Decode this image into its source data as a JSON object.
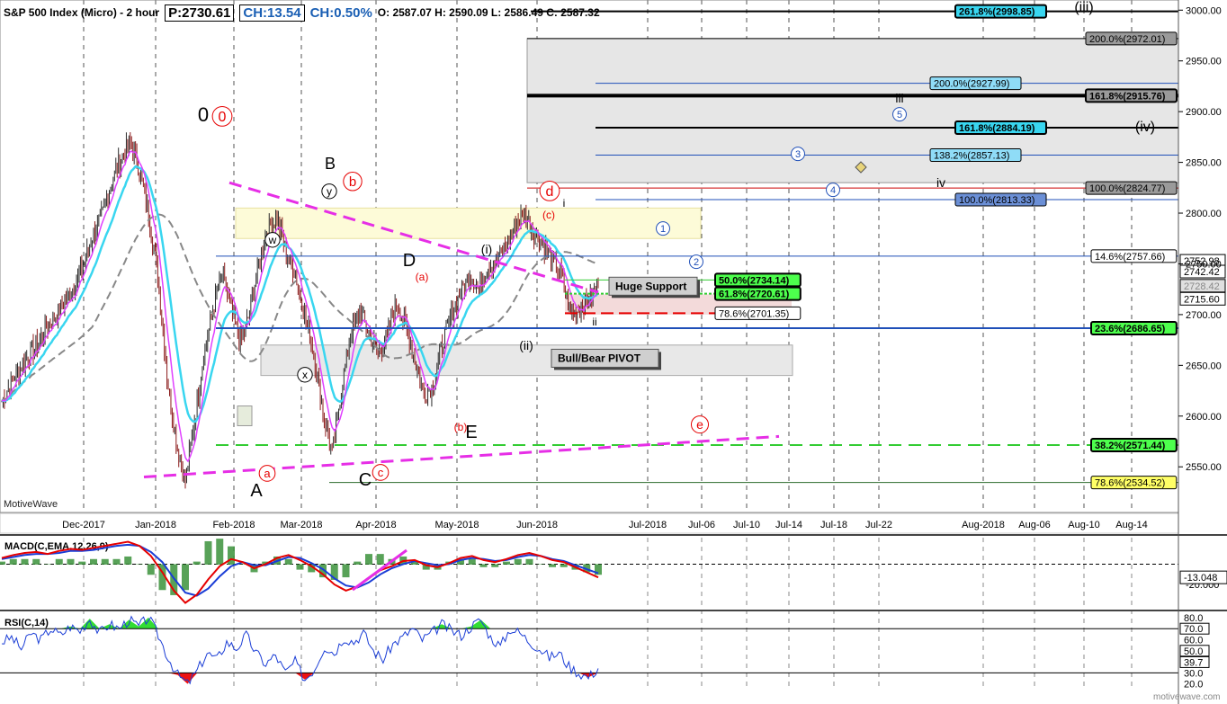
{
  "header": {
    "title": "S&P 500 Index (Micro) - 2 hour",
    "price": "P:2730.61",
    "change": "CH:13.54",
    "change_pct": "CH:0.50%",
    "ohlc": "O: 2587.07  H: 2590.09  L: 2586.49  C: 2587.32"
  },
  "watermarks": {
    "brand": "MotiveWave",
    "site": "motivewave.com"
  },
  "colors": {
    "price_up": "#1a1a1a",
    "ema_fast": "#e040ff",
    "ema_mid": "#39d6f0",
    "sma_slow": "#888888",
    "trend_pink": "#e62ee6",
    "support_green": "#33cc33",
    "resist_red": "#e60000",
    "fib_blue": "#1f4fb8",
    "macd_line": "#e60000",
    "macd_signal": "#1a3dd6",
    "macd_hist": "#2e8b2e",
    "rsi_line": "#1a3dd6"
  },
  "chart_data": [
    {
      "type": "line",
      "title": "S&P 500 Index (Micro) - 2 hour",
      "x_ticks": [
        "Dec-2017",
        "Jan-2018",
        "Feb-2018",
        "Mar-2018",
        "Apr-2018",
        "May-2018",
        "Jun-2018",
        "Jul-2018",
        "Jul-06",
        "Jul-10",
        "Jul-14",
        "Jul-18",
        "Jul-22",
        "Aug-2018",
        "Aug-06",
        "Aug-10",
        "Aug-14"
      ],
      "y_ticks": [
        2550,
        2600,
        2650,
        2700,
        2750,
        2800,
        2850,
        2900,
        2950,
        3000
      ],
      "ylim": [
        2505,
        3010
      ],
      "series": [
        {
          "values": [
            2615,
            2632,
            2648,
            2661,
            2672,
            2690,
            2700,
            2715,
            2730,
            2752,
            2780,
            2800,
            2832,
            2855,
            2868,
            2842,
            2800,
            2740,
            2640,
            2575,
            2535,
            2595,
            2660,
            2705,
            2740,
            2705,
            2672,
            2700,
            2752,
            2785,
            2795,
            2760,
            2740,
            2700,
            2662,
            2605,
            2563,
            2625,
            2680,
            2705,
            2682,
            2662,
            2680,
            2712,
            2690,
            2655,
            2620,
            2630,
            2672,
            2700,
            2722,
            2740,
            2725,
            2748,
            2755,
            2768,
            2790,
            2798,
            2782,
            2770,
            2752,
            2740,
            2700,
            2705,
            2716,
            2730
          ]
        }
      ],
      "price_labels": [
        "2752.98",
        "2742.42",
        "2728.42",
        "2715.60"
      ],
      "fib_levels": [
        {
          "label": "261.8%(2998.85)",
          "value": 2998.85
        },
        {
          "label": "200.0%(2972.01)",
          "value": 2972.01
        },
        {
          "label": "200.0%(2927.99)",
          "value": 2927.99
        },
        {
          "label": "161.8%(2915.76)",
          "value": 2915.76
        },
        {
          "label": "161.8%(2884.19)",
          "value": 2884.19
        },
        {
          "label": "138.2%(2857.13)",
          "value": 2857.13
        },
        {
          "label": "100.0%(2824.77)",
          "value": 2824.77
        },
        {
          "label": "100.0%(2813.33)",
          "value": 2813.33
        },
        {
          "label": "14.6%(2757.66)",
          "value": 2757.66
        },
        {
          "label": "50.0%(2734.14)",
          "value": 2734.14
        },
        {
          "label": "61.8%(2720.61)",
          "value": 2720.61
        },
        {
          "label": "78.6%(2701.35)",
          "value": 2701.35
        },
        {
          "label": "23.6%(2686.65)",
          "value": 2686.65
        },
        {
          "label": "38.2%(2571.44)",
          "value": 2571.44
        },
        {
          "label": "78.6%(2534.52)",
          "value": 2534.52
        }
      ],
      "annotations": [
        "Huge Support",
        "Bull/Bear PIVOT"
      ],
      "wave_labels": [
        "0",
        "0",
        "A",
        "a",
        "B",
        "b",
        "(y)",
        "(w)",
        "(x)",
        "C",
        "c",
        "D",
        "(a)",
        "E",
        "(b)",
        "(i)",
        "(ii)",
        "d",
        "(c)",
        "i",
        "ii",
        "iii",
        "iv",
        "(iii)",
        "(iv)",
        "1",
        "2",
        "3",
        "4",
        "5",
        "e"
      ]
    },
    {
      "type": "line",
      "title": "MACD(C,EMA,12,26,9)",
      "y_ticks": [
        "-20.000"
      ],
      "value_label": "-13.048",
      "series": [
        {
          "values": [
            6,
            9,
            11,
            12,
            10,
            13,
            15,
            14,
            16,
            18,
            20,
            22,
            18,
            8,
            -8,
            -26,
            -38,
            -30,
            -15,
            -2,
            5,
            2,
            -4,
            0,
            6,
            9,
            4,
            -2,
            -10,
            -20,
            -26,
            -22,
            -14,
            -6,
            -2,
            3,
            4,
            -1,
            -3,
            1,
            6,
            8,
            4,
            2,
            5,
            9,
            11,
            8,
            4,
            2,
            -3,
            -8,
            -13
          ]
        },
        {
          "values": [
            5,
            7,
            9,
            10,
            10,
            11,
            13,
            13,
            14,
            16,
            18,
            19,
            18,
            12,
            2,
            -14,
            -28,
            -31,
            -24,
            -12,
            -2,
            2,
            -1,
            -1,
            3,
            7,
            6,
            1,
            -5,
            -14,
            -21,
            -23,
            -18,
            -10,
            -4,
            0,
            3,
            1,
            -1,
            0,
            4,
            6,
            5,
            3,
            4,
            7,
            9,
            8,
            5,
            3,
            -1,
            -5,
            -9
          ]
        }
      ]
    },
    {
      "type": "line",
      "title": "RSI(C,14)",
      "y_ticks": [
        "80.0",
        "70.0",
        "60.0",
        "50.0",
        "39.7",
        "30.0",
        "20.0"
      ],
      "ylim": [
        14,
        84
      ],
      "series": [
        {
          "values": [
            58,
            62,
            52,
            66,
            60,
            70,
            64,
            72,
            68,
            79,
            66,
            74,
            70,
            78,
            72,
            80,
            64,
            44,
            28,
            20,
            32,
            48,
            42,
            58,
            52,
            64,
            48,
            38,
            46,
            30,
            40,
            24,
            34,
            54,
            48,
            62,
            58,
            66,
            50,
            42,
            56,
            62,
            70,
            60,
            66,
            74,
            68,
            64,
            72,
            78,
            62,
            54,
            70,
            66,
            58,
            52,
            44,
            48,
            36,
            30,
            26,
            34
          ]
        }
      ]
    }
  ]
}
